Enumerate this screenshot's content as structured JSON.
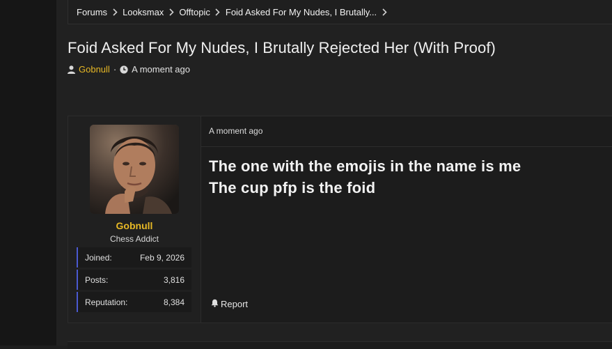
{
  "breadcrumb": {
    "items": [
      "Forums",
      "Looksmax",
      "Offtopic",
      "Foid Asked For My Nudes, I Brutally..."
    ]
  },
  "thread": {
    "title": "Foid Asked For My Nudes, I Brutally Rejected Her (With Proof)",
    "author": "Gobnull",
    "separator": "·",
    "time": "A moment ago"
  },
  "post": {
    "user": {
      "name": "Gobnull",
      "title": "Chess Addict",
      "stats": [
        {
          "label": "Joined:",
          "value": "Feb 9, 2026"
        },
        {
          "label": "Posts:",
          "value": "3,816"
        },
        {
          "label": "Reputation:",
          "value": "8,384"
        }
      ]
    },
    "date": "A moment ago",
    "body_lines": [
      "The one with the emojis in the name is me",
      "The cup pfp is the foid"
    ],
    "report_label": "Report"
  },
  "colors": {
    "accent": "#e7b825",
    "stat_border": "#4b5ad1",
    "background": "#212121"
  },
  "icons": [
    "chevron-right-icon",
    "user-icon",
    "clock-icon",
    "bell-icon"
  ]
}
